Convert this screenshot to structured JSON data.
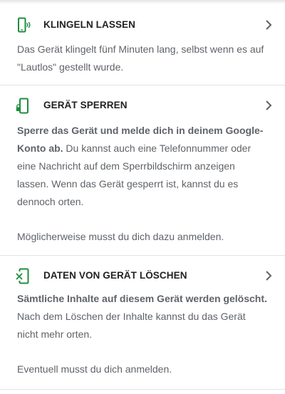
{
  "sections": [
    {
      "title": "KLINGELN LASSEN",
      "icon": "phone-ring-icon",
      "description": "Das Gerät klingelt fünf Minuten lang, selbst wenn es auf \"Lautlos\" gestellt wurde."
    },
    {
      "title": "GERÄT SPERREN",
      "icon": "phone-lock-icon",
      "bold_text": "Sperre das Gerät und melde dich in deinem Google-Konto ab.",
      "description": " Du kannst auch eine Telefonnummer oder eine Nachricht auf dem Sperrbildschirm anzeigen lassen. Wenn das Gerät gesperrt ist, kannst du es dennoch orten.",
      "note": "Möglicherweise musst du dich dazu anmelden."
    },
    {
      "title": "DATEN VON GERÄT LÖSCHEN",
      "icon": "phone-erase-icon",
      "bold_text": "Sämtliche Inhalte auf diesem Gerät werden gelöscht.",
      "description": " Nach dem Löschen der Inhalte kannst du das Gerät nicht mehr orten.",
      "note": "Eventuell musst du dich anmelden."
    }
  ],
  "colors": {
    "accent": "#1e8e3e",
    "title": "#202124",
    "text": "#5f6368",
    "divider": "#e3e3e3"
  }
}
